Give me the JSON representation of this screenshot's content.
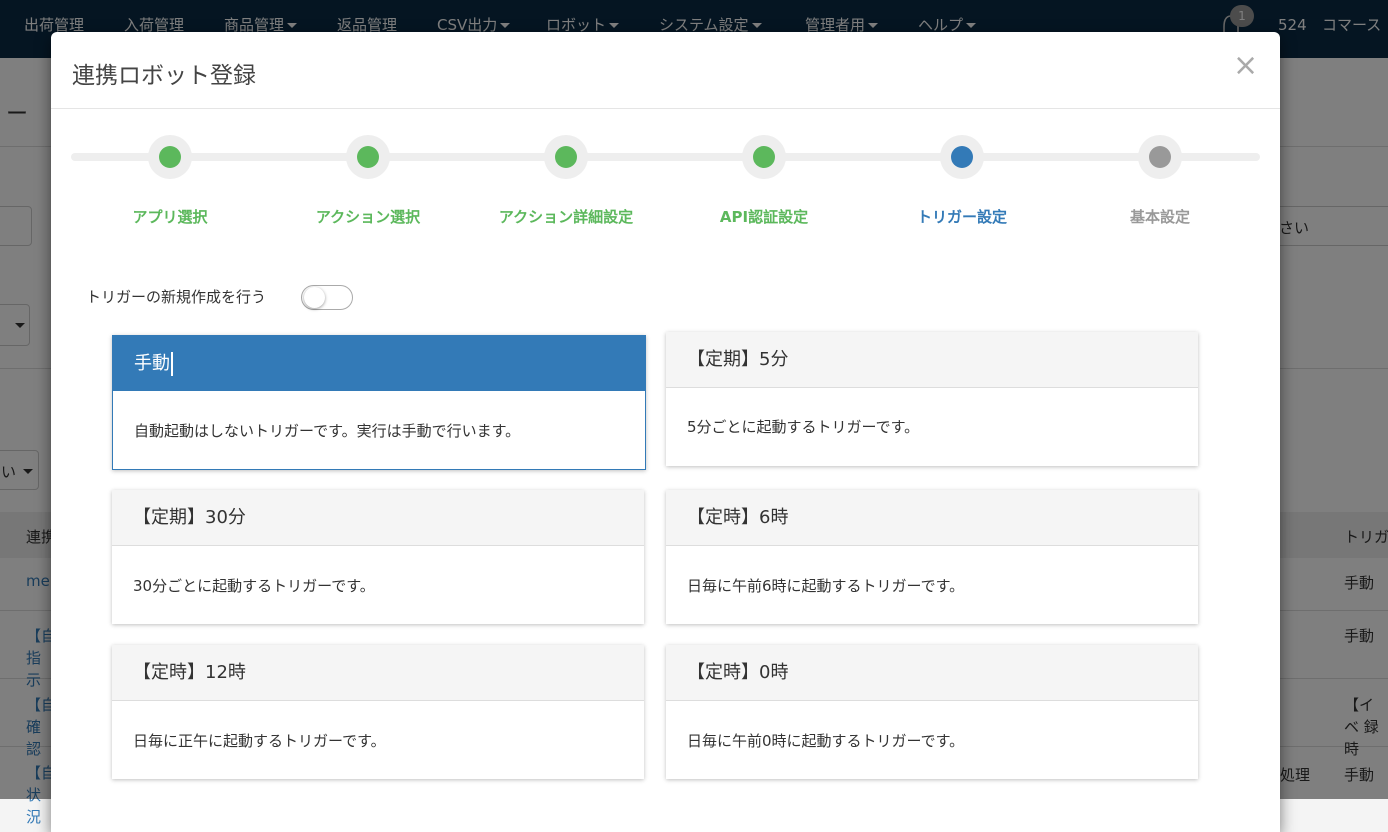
{
  "nav": {
    "items": [
      "出荷管理",
      "入荷管理",
      "商品管理",
      "返品管理",
      "CSV出力",
      "ロボット",
      "システム設定",
      "管理者用",
      "ヘルプ"
    ],
    "notification_count": "1",
    "user_id": "524",
    "user_name": "コマース"
  },
  "background": {
    "fragment_title": "ー",
    "select_fragment": "さい",
    "dropdown_fragment": "い",
    "table_header_left": "連携",
    "table_header_right": "トリガ",
    "rows": [
      {
        "left": "me",
        "right": "手動"
      },
      {
        "left": "【自 指示",
        "right": "手動"
      },
      {
        "left": "【自 確認",
        "right": "【イベ 録時"
      },
      {
        "left": "【自 状況",
        "mid": "処理",
        "right": "手動"
      }
    ]
  },
  "modal": {
    "title": "連携ロボット登録",
    "close": "×",
    "steps": [
      {
        "label": "アプリ選択",
        "state": "done",
        "color": "#5cb85c"
      },
      {
        "label": "アクション選択",
        "state": "done",
        "color": "#5cb85c"
      },
      {
        "label": "アクション詳細設定",
        "state": "done",
        "color": "#5cb85c"
      },
      {
        "label": "API認証設定",
        "state": "done",
        "color": "#5cb85c"
      },
      {
        "label": "トリガー設定",
        "state": "current",
        "color": "#337ab7"
      },
      {
        "label": "基本設定",
        "state": "pending",
        "color": "#999999"
      }
    ],
    "toggle_label": "トリガーの新規作成を行う",
    "toggle_on": false,
    "triggers": [
      {
        "title": "手動",
        "desc": "自動起動はしないトリガーです。実行は手動で行います。",
        "selected": true
      },
      {
        "title": "【定期】5分",
        "desc": "5分ごとに起動するトリガーです。",
        "selected": false
      },
      {
        "title": "【定期】30分",
        "desc": "30分ごとに起動するトリガーです。",
        "selected": false
      },
      {
        "title": "【定時】6時",
        "desc": "日毎に午前6時に起動するトリガーです。",
        "selected": false
      },
      {
        "title": "【定時】12時",
        "desc": "日毎に正午に起動するトリガーです。",
        "selected": false
      },
      {
        "title": "【定時】0時",
        "desc": "日毎に午前0時に起動するトリガーです。",
        "selected": false
      }
    ]
  }
}
